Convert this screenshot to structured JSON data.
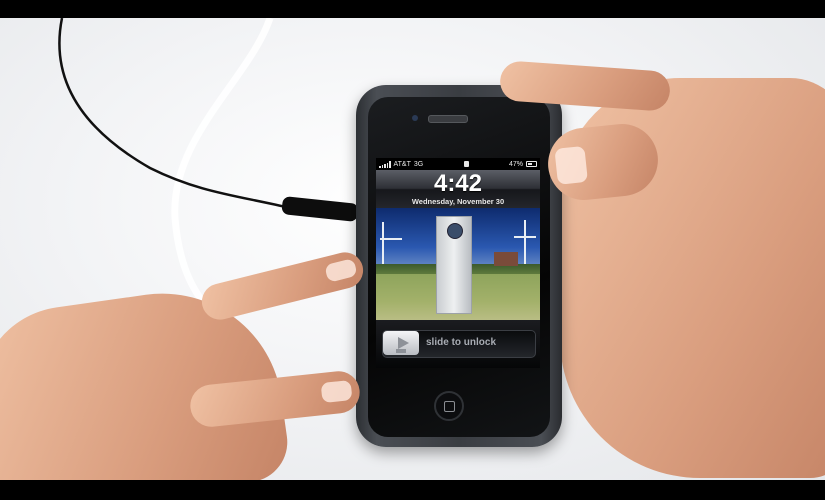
{
  "status_bar": {
    "carrier": "AT&T",
    "network": "3G",
    "battery_percent": "47%",
    "battery_level": 0.47
  },
  "lock_screen": {
    "time": "4:42",
    "date": "Wednesday, November 30",
    "slider_label": "slide to unlock"
  },
  "colors": {
    "frame": "#000000",
    "phone_case": "#3a3d42",
    "skin": "#d99d7e"
  }
}
